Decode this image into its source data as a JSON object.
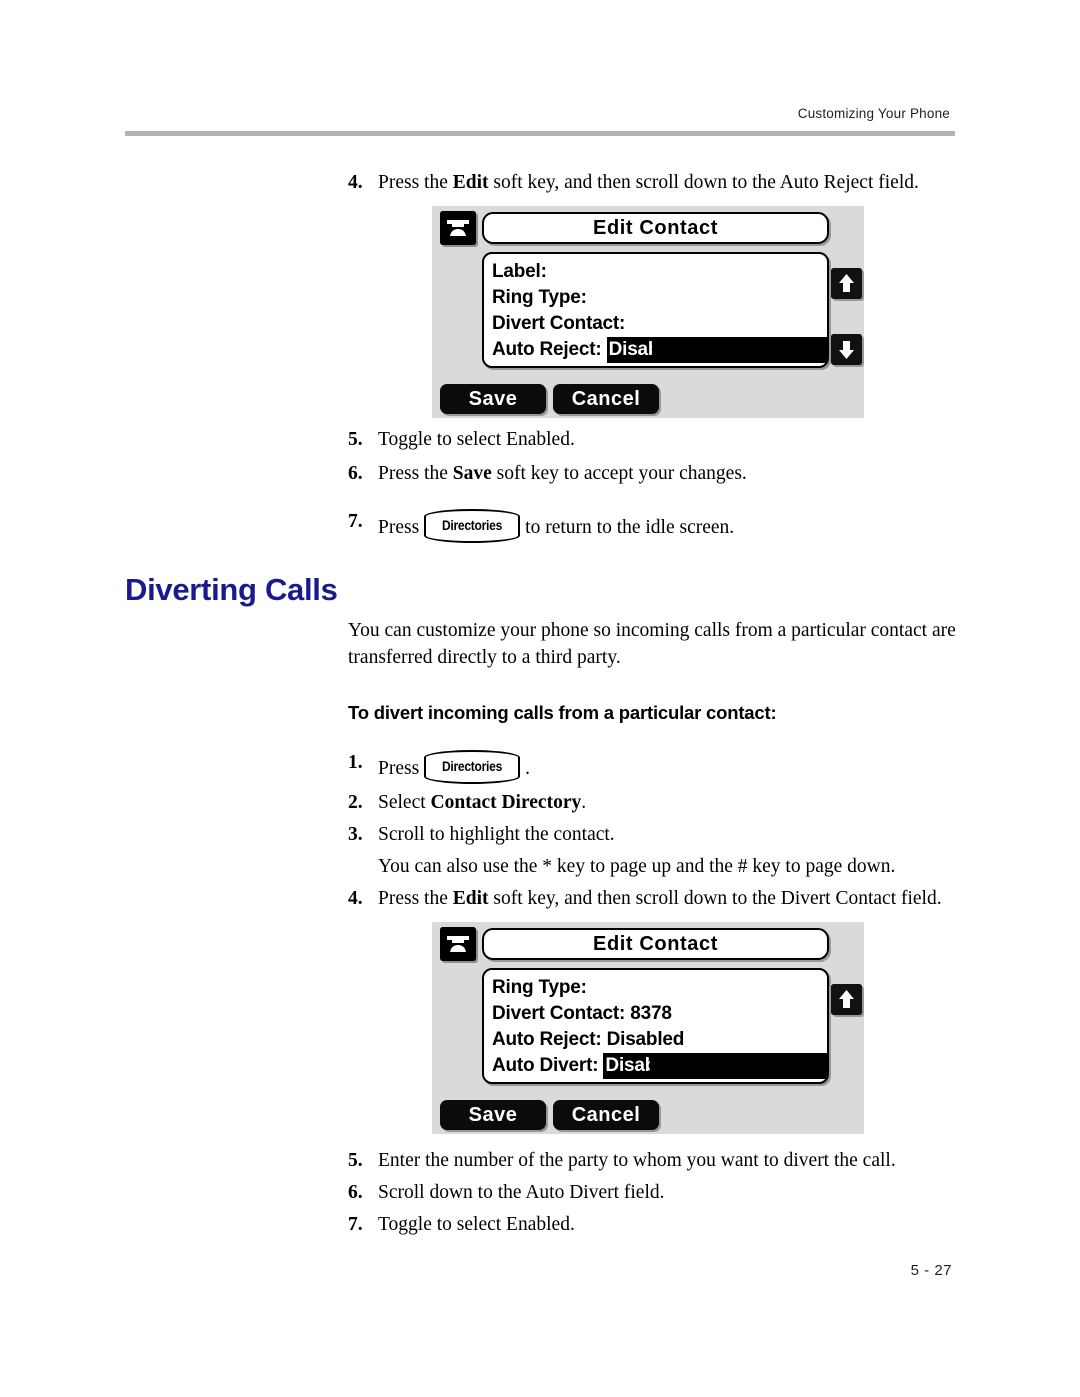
{
  "header": {
    "running_head": "Customizing Your Phone"
  },
  "footer": {
    "page_number": "5 - 27"
  },
  "colors": {
    "heading_blue": "#1a1a8e",
    "rule_gray": "#b3b3b3",
    "lcd_background": "#dadada"
  },
  "top_section": {
    "step4": {
      "number": "4.",
      "text_before": "Press the ",
      "bold": "Edit",
      "text_after": " soft key, and then scroll down to the Auto Reject field."
    },
    "step5": {
      "number": "5.",
      "text": "Toggle to select Enabled."
    },
    "step6": {
      "number": "6.",
      "text_before": "Press the ",
      "bold": "Save",
      "text_after": " soft key to accept your changes."
    },
    "step7": {
      "number": "7.",
      "text_before": "Press",
      "key_label": "Directories",
      "text_after": "to return to the idle screen."
    }
  },
  "lcd_1": {
    "icon": "phone-handset-icon",
    "title": "Edit Contact",
    "rows": [
      {
        "label": "Label:",
        "value": "",
        "selected": false
      },
      {
        "label": "Ring Type:",
        "value": "",
        "selected": false
      },
      {
        "label": "Divert Contact:",
        "value": "",
        "selected": false
      },
      {
        "label": "Auto Reject:",
        "value": "Disabled",
        "selected": true
      }
    ],
    "scroll_up": "up-arrow-icon",
    "scroll_down": "down-arrow-icon",
    "softkeys": [
      "Save",
      "Cancel"
    ]
  },
  "diverting_section": {
    "title": "Diverting Calls",
    "intro": "You can customize your phone so incoming calls from a particular contact are transferred directly to a third party.",
    "sub_head": "To divert incoming calls from a particular contact:",
    "step1": {
      "number": "1.",
      "text_before": "Press",
      "key_label": "Directories",
      "text_after": "."
    },
    "step2": {
      "number": "2.",
      "text_before": "Select ",
      "bold": "Contact Directory",
      "text_after": "."
    },
    "step3": {
      "number": "3.",
      "text": "Scroll to highlight the contact."
    },
    "step3_note": "You can also use the * key to page up and the # key to page down.",
    "step4": {
      "number": "4.",
      "text_before": "Press the ",
      "bold": "Edit",
      "text_after": " soft key, and then scroll down to the Divert Contact field."
    },
    "step5": {
      "number": "5.",
      "text": "Enter the number of the party to whom you want to divert the call."
    },
    "step6": {
      "number": "6.",
      "text": "Scroll down to the Auto Divert field."
    },
    "step7": {
      "number": "7.",
      "text": "Toggle to select Enabled."
    }
  },
  "lcd_2": {
    "icon": "phone-handset-icon",
    "title": "Edit Contact",
    "rows": [
      {
        "label": "Ring Type:",
        "value": "",
        "selected": false
      },
      {
        "label": "Divert Contact:",
        "value": "8378",
        "selected": false
      },
      {
        "label": "Auto Reject:",
        "value": "Disabled",
        "selected": false
      },
      {
        "label": "Auto Divert:",
        "value": "Disabled",
        "selected": true
      }
    ],
    "scroll_up": "up-arrow-icon",
    "softkeys": [
      "Save",
      "Cancel"
    ]
  }
}
